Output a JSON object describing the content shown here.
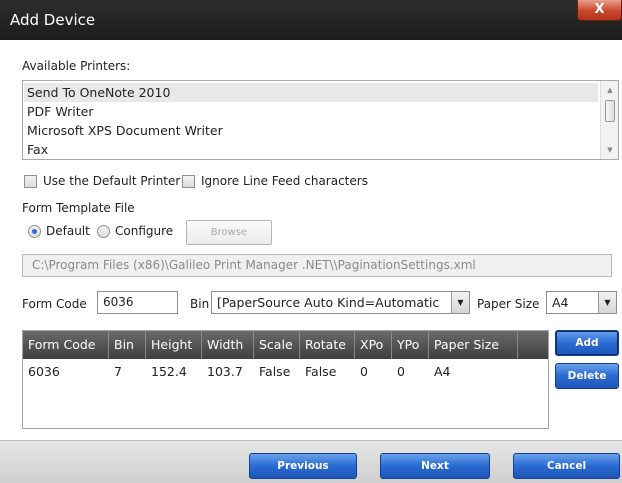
{
  "window": {
    "title": "Add Device",
    "close_glyph": "X"
  },
  "available_printers": {
    "label": "Available Printers:",
    "items": [
      "Send To OneNote 2010",
      "PDF Writer",
      "Microsoft XPS Document Writer",
      "Fax"
    ],
    "selected_index": 0
  },
  "options": {
    "use_default_printer": {
      "label": "Use the Default Printer",
      "checked": false
    },
    "ignore_line_feed": {
      "label": "Ignore Line Feed characters",
      "checked": false
    }
  },
  "form_template": {
    "label": "Form Template File",
    "radio_default": {
      "label": "Default",
      "selected": true
    },
    "radio_configure": {
      "label": "Configure",
      "selected": false
    },
    "browse_label": "Browse",
    "path": "C:\\Program Files (x86)\\Galileo Print Manager .NET\\\\PaginationSettings.xml"
  },
  "form_row": {
    "form_code_label": "Form Code",
    "form_code_value": "6036",
    "bin_label": "Bin",
    "bin_value": "[PaperSource Auto Kind=Automatic",
    "paper_size_label": "Paper Size",
    "paper_size_value": "A4"
  },
  "grid": {
    "columns": [
      "Form Code",
      "Bin",
      "Height",
      "Width",
      "Scale",
      "Rotate",
      "XPo",
      "YPo",
      "Paper Size"
    ],
    "rows": [
      [
        "6036",
        "7",
        "152.4",
        "103.7",
        "False",
        "False",
        "0",
        "0",
        "A4"
      ]
    ]
  },
  "side_buttons": {
    "add": "Add",
    "delete": "Delete"
  },
  "footer": {
    "previous": "Previous",
    "next": "Next",
    "cancel": "Cancel"
  },
  "colors": {
    "accent_blue": "#2a6ad2",
    "titlebar": "#1c1c1c",
    "close_red": "#c9462d"
  },
  "icons": {
    "close": "close-icon",
    "scroll_up": "chevron-up-icon",
    "scroll_down": "chevron-down-icon",
    "dropdown": "chevron-down-icon"
  }
}
